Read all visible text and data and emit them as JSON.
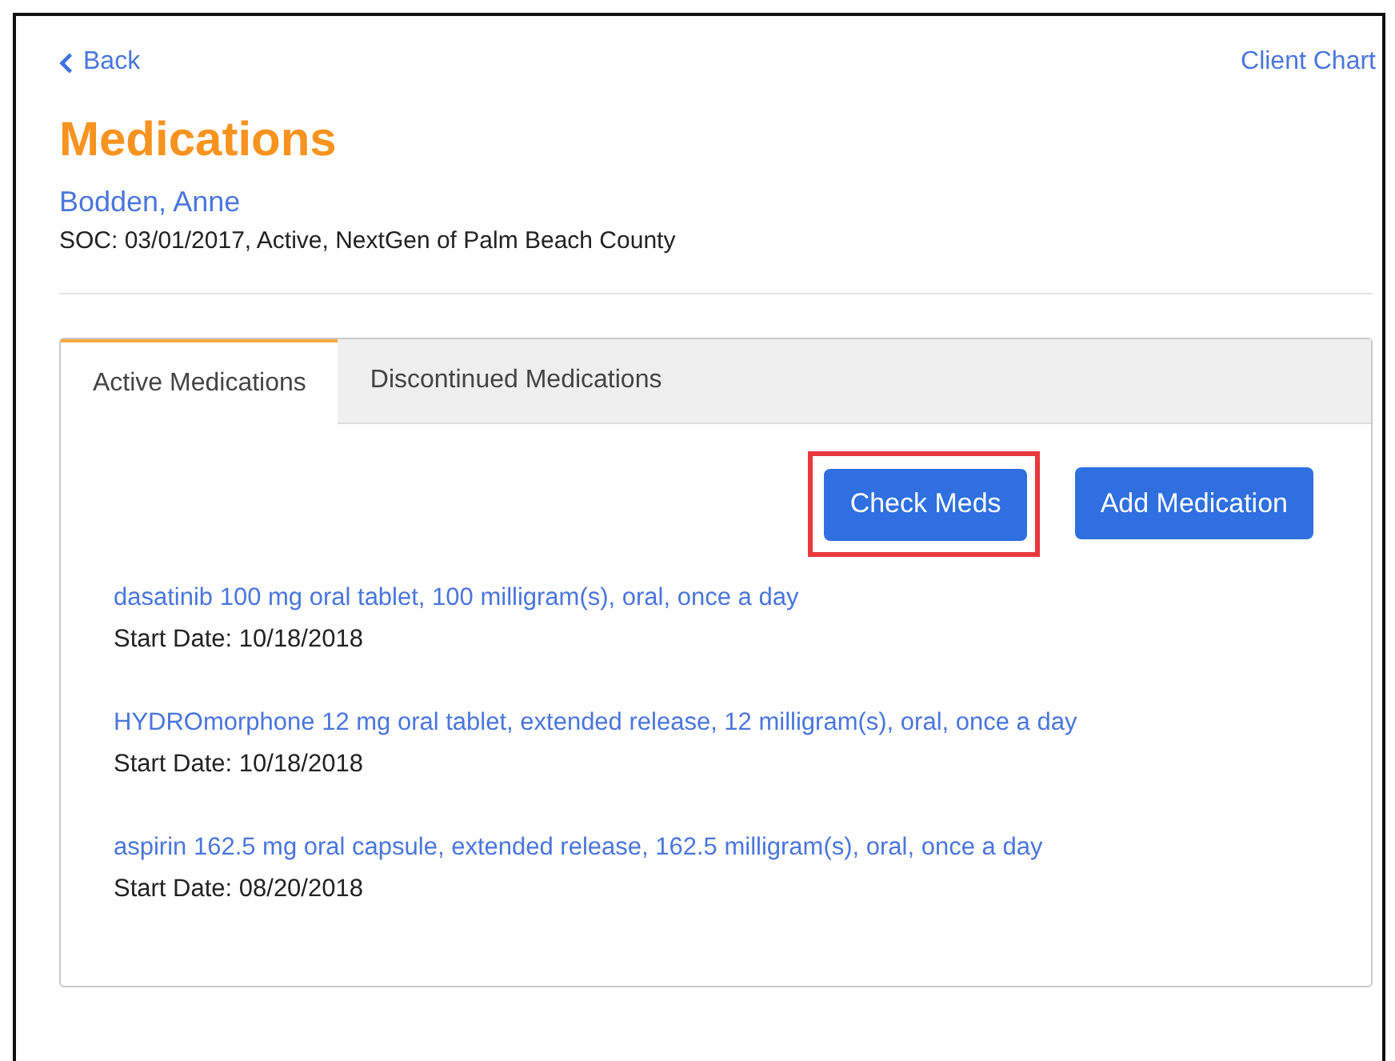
{
  "nav": {
    "back": "Back",
    "right_link": "Client Chart"
  },
  "title": "Medications",
  "client": {
    "name": "Bodden, Anne",
    "details": "SOC: 03/01/2017, Active, NextGen of Palm Beach County"
  },
  "tabs": [
    {
      "label": "Active Medications",
      "selected": true
    },
    {
      "label": "Discontinued Medications",
      "selected": false
    }
  ],
  "buttons": [
    {
      "label": "Check Meds",
      "highlighted": true
    },
    {
      "label": "Add Medication",
      "highlighted": false
    }
  ],
  "medications": [
    {
      "name": "dasatinib 100 mg oral tablet, 100 milligram(s), oral, once a day",
      "start": "Start Date: 10/18/2018"
    },
    {
      "name": "HYDROmorphone 12 mg oral tablet, extended release, 12 milligram(s), oral, once a day",
      "start": "Start Date: 10/18/2018"
    },
    {
      "name": "aspirin 162.5 mg oral capsule, extended release, 162.5 milligram(s), oral, once a day",
      "start": "Start Date: 08/20/2018"
    }
  ]
}
